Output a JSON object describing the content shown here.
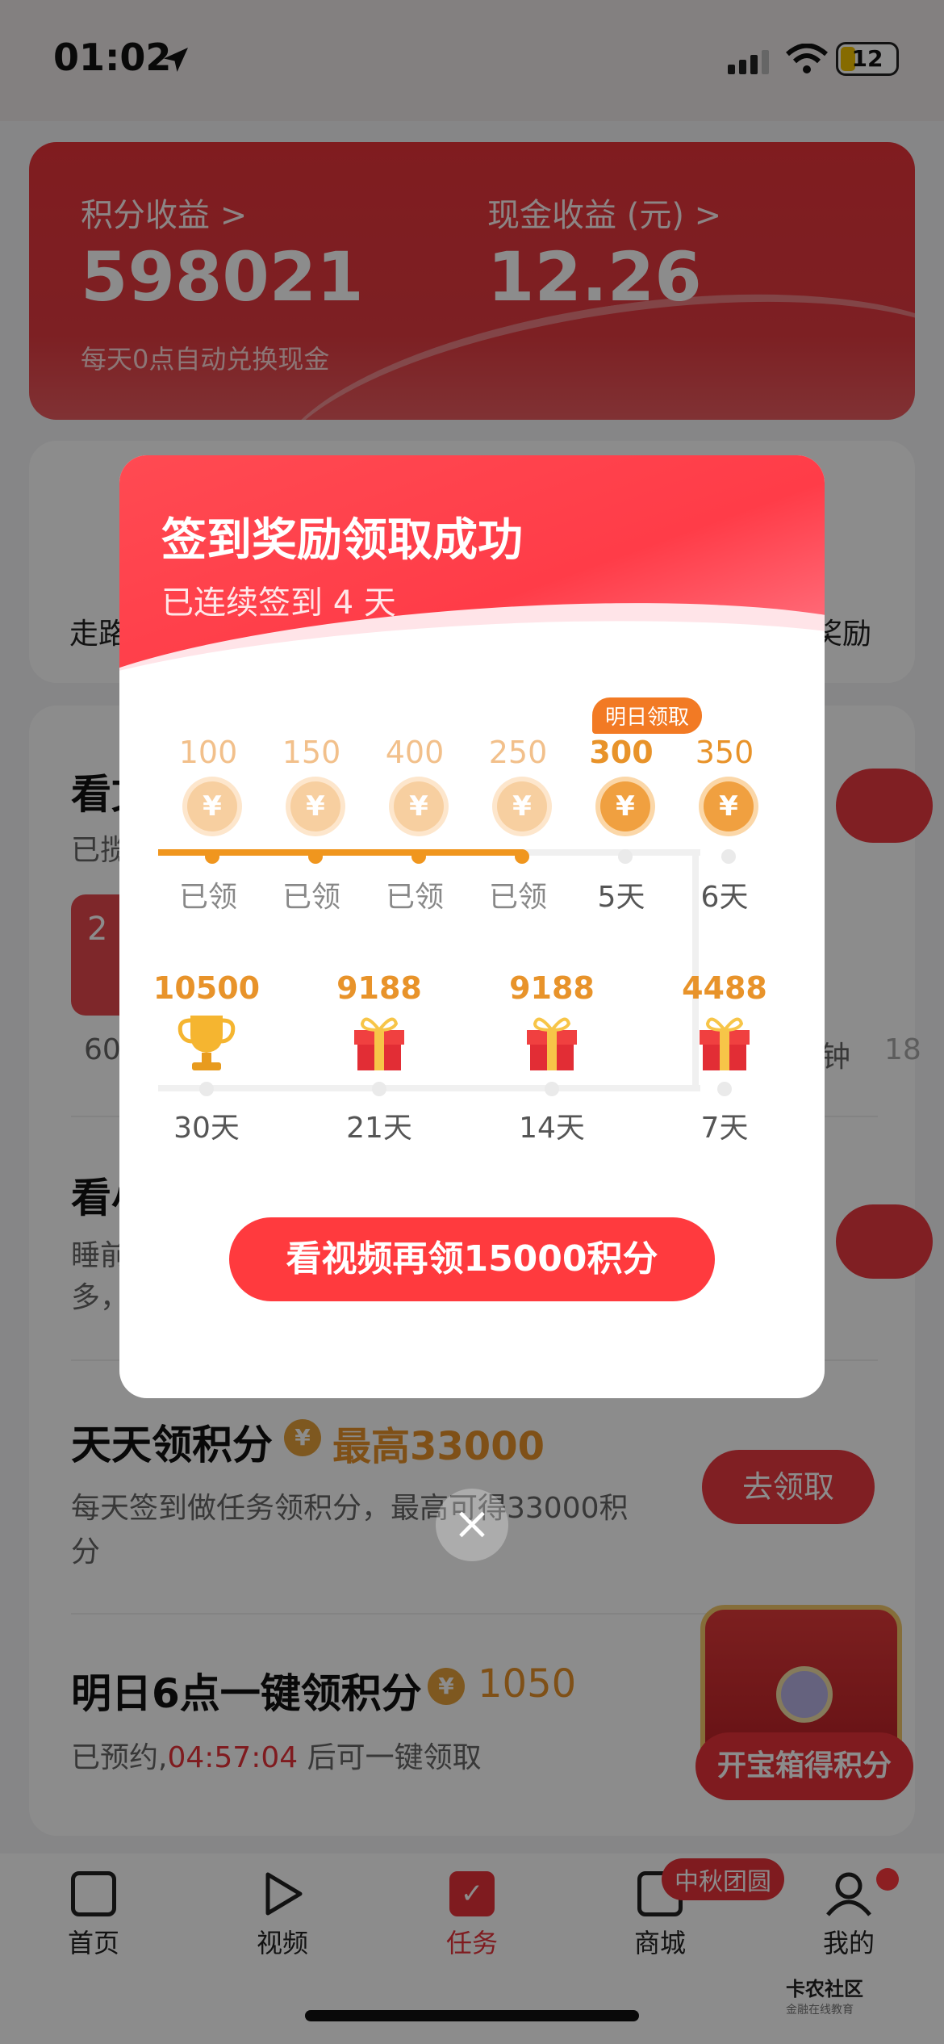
{
  "status_bar": {
    "time": "01:02",
    "battery": "12"
  },
  "earnings": {
    "points_label": "积分收益 >",
    "points_value": "598021",
    "cash_label": "现金收益 (元) >",
    "cash_value": "12.26",
    "note": "每天0点自动兑换现金"
  },
  "bg": {
    "walk_label": "走路",
    "reward_label": "奖励",
    "read_title": "看文",
    "read_desc": "已揽",
    "card_num": "2",
    "card_sub": "60",
    "min_label": "钟",
    "eighteen": "18",
    "sleep_title": "看小",
    "sleep_desc": "睡前",
    "sleep_desc2": "多，",
    "daily_title": "天天领积分",
    "daily_badge": "最高33000",
    "daily_desc": "每天签到做任务领积分，最高可得33000积分",
    "daily_btn": "去领取",
    "tomorrow_title": "明日6点一键领积分",
    "tomorrow_badge": "1050",
    "tomorrow_prefix": "已预约,",
    "tomorrow_time": "04:57:04",
    "tomorrow_suffix": "后可一键领取",
    "chest_label": "开宝箱得积分"
  },
  "modal": {
    "title": "签到奖励领取成功",
    "subtitle": "已连续签到 4 天",
    "tomorrow_tag": "明日领取",
    "row1": [
      {
        "amount": "100",
        "day": "已领",
        "state": "done"
      },
      {
        "amount": "150",
        "day": "已领",
        "state": "done"
      },
      {
        "amount": "400",
        "day": "已领",
        "state": "done"
      },
      {
        "amount": "250",
        "day": "已领",
        "state": "done"
      },
      {
        "amount": "300",
        "day": "5天",
        "state": "next"
      },
      {
        "amount": "350",
        "day": "6天",
        "state": "next"
      }
    ],
    "row2": [
      {
        "amount": "10500",
        "day": "30天",
        "icon": "trophy"
      },
      {
        "amount": "9188",
        "day": "21天",
        "icon": "gift"
      },
      {
        "amount": "9188",
        "day": "14天",
        "icon": "gift"
      },
      {
        "amount": "4488",
        "day": "7天",
        "icon": "gift"
      }
    ],
    "cta": "看视频再领15000积分",
    "close": "×"
  },
  "tabs": [
    {
      "label": "首页",
      "active": false
    },
    {
      "label": "视频",
      "active": false
    },
    {
      "label": "任务",
      "active": true
    },
    {
      "label": "商城",
      "active": false,
      "badge": "中秋团圆"
    },
    {
      "label": "我的",
      "active": false
    }
  ],
  "watermark": {
    "name": "卡农社区",
    "sub": "金融在线教育"
  },
  "colors": {
    "accent": "#ea3a40",
    "gold": "#e8932a",
    "overlay": "rgba(0,0,0,.45)"
  }
}
